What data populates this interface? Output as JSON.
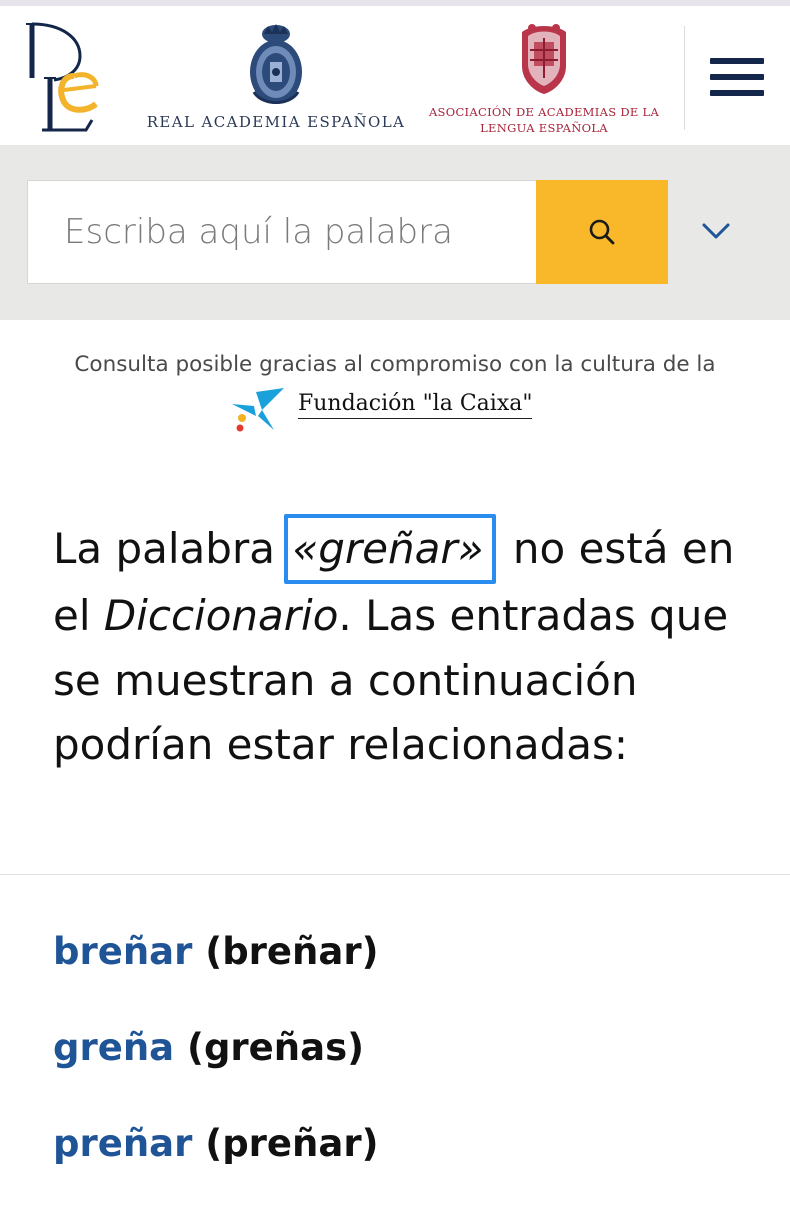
{
  "header": {
    "rae_name": "REAL ACADEMIA ESPAÑOLA",
    "asale_name": "ASOCIACIÓN DE ACADEMIAS DE LA LENGUA ESPAÑOLA",
    "icons": [
      "dle-logo",
      "rae-emblem-icon",
      "asale-emblem-icon",
      "menu-icon"
    ]
  },
  "search": {
    "placeholder": "Escriba aquí la palabra",
    "value": "",
    "button_icon": "search-icon",
    "dropdown_icon": "chevron-down-icon"
  },
  "sponsor": {
    "text": "Consulta posible gracias al compromiso con la cultura de la",
    "name": "Fundación \"la Caixa\"",
    "icon": "caixa-star-icon"
  },
  "notice": {
    "prefix": "La palabra ",
    "word": "«greñar»",
    "mid": " no está en el ",
    "dictionary": "Diccionario",
    "suffix": ". Las entradas que se muestran a continuación podrían estar relacionadas:"
  },
  "results": [
    {
      "lemma": "breñar",
      "form": "(breñar)"
    },
    {
      "lemma": "greña",
      "form": "(greñas)"
    },
    {
      "lemma": "preñar",
      "form": "(preñar)"
    }
  ],
  "colors": {
    "navy": "#14264a",
    "gold": "#f8b82a",
    "asale_red": "#a8243a",
    "link_blue": "#1f5496",
    "highlight_blue": "#2b8cf0",
    "search_band": "#e8e8e6"
  }
}
